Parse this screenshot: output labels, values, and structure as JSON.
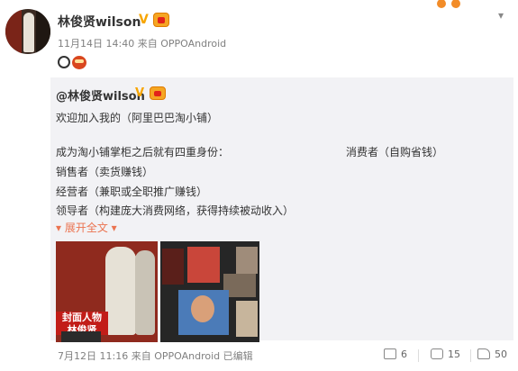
{
  "post": {
    "author": "林俊贤wilson",
    "time": "11月14日 14:40",
    "source": "来自 OPPOAndroid",
    "v_badge": "V"
  },
  "repost": {
    "author": "@林俊贤wilson",
    "v_badge": "V",
    "lines": [
      "欢迎加入我的（阿里巴巴淘小铺）",
      "成为淘小铺掌柜之后就有四重身份：",
      "销售者（卖货赚钱）",
      "经营者（兼职或全职推广赚钱）",
      "领导者（构建庞大消费网络，获得持续被动收入）"
    ],
    "right_text": "消费者（自购省钱）",
    "expand": "▾ 展开全文 ▾",
    "pic1_caption": "封面人物",
    "pic1_name": "林俊贤",
    "footer_time": "7月12日 11:16",
    "footer_source": "来自 OPPOAndroid",
    "footer_edited": "已编辑",
    "shares": "6",
    "comments": "15",
    "likes": "50"
  },
  "icons": {
    "chevron": "chevron-down-icon"
  }
}
